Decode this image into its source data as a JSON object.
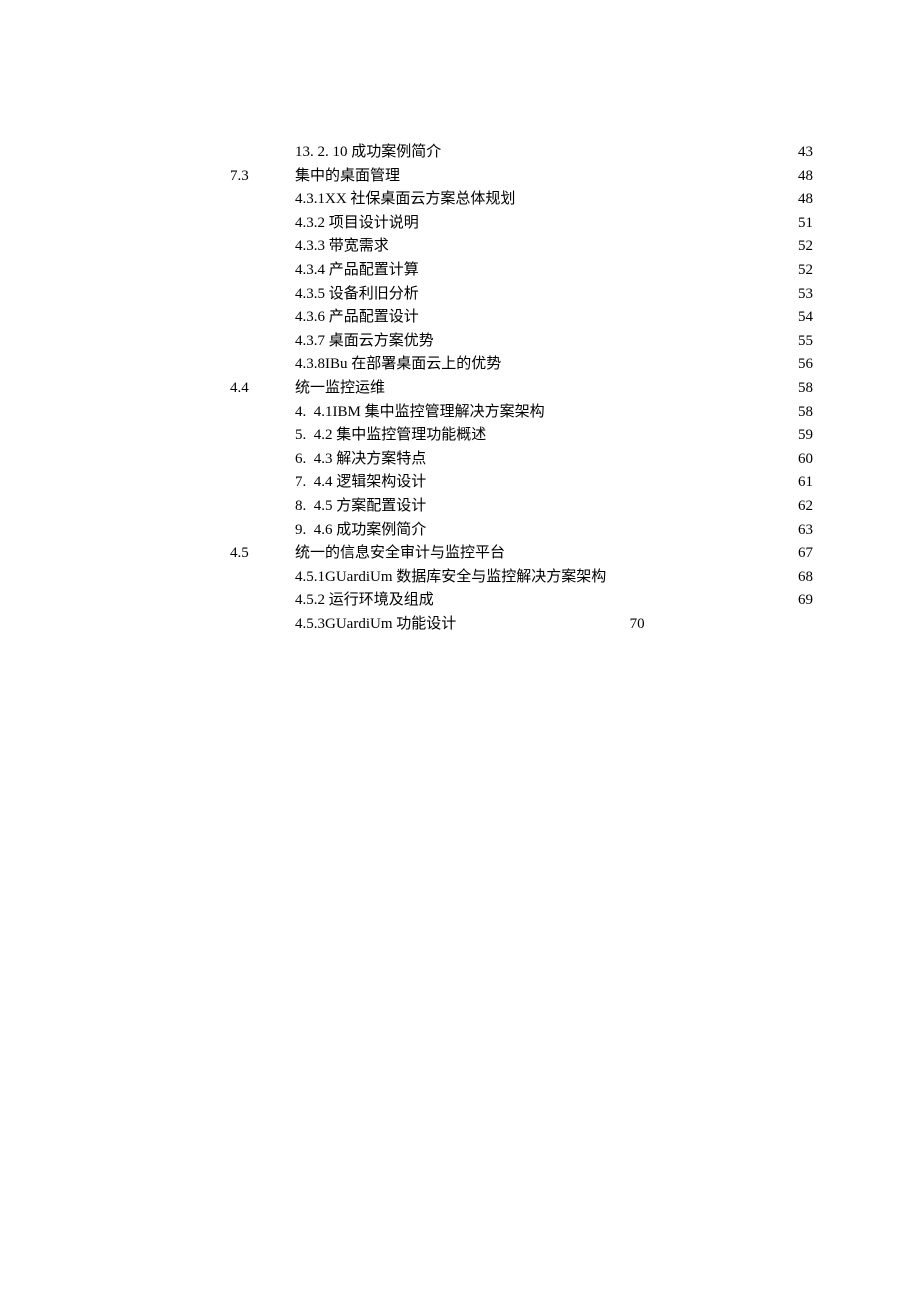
{
  "rows": [
    {
      "sec": "",
      "title": "13. 2. 10 成功案例简介",
      "page": "43"
    },
    {
      "sec": "7.3",
      "title": "集中的桌面管理",
      "page": "48"
    },
    {
      "sec": "",
      "title": "4.3.1XX 社保桌面云方案总体规划",
      "page": "48"
    },
    {
      "sec": "",
      "title": "4.3.2 项目设计说明",
      "page": "51"
    },
    {
      "sec": "",
      "title": "4.3.3 带宽需求",
      "page": "52"
    },
    {
      "sec": "",
      "title": "4.3.4 产品配置计算",
      "page": "52"
    },
    {
      "sec": "",
      "title": "4.3.5 设备利旧分析",
      "page": "53"
    },
    {
      "sec": "",
      "title": "4.3.6 产品配置设计",
      "page": "54"
    },
    {
      "sec": "",
      "title": "4.3.7 桌面云方案优势",
      "page": "55"
    },
    {
      "sec": "",
      "title": "4.3.8IBu 在部署桌面云上的优势",
      "page": "56"
    },
    {
      "sec": "4.4",
      "title": "统一监控运维",
      "page": "58"
    },
    {
      "sec": "",
      "title": "4.  4.1IBM 集中监控管理解决方案架构",
      "page": "58"
    },
    {
      "sec": "",
      "title": "5.  4.2 集中监控管理功能概述",
      "page": "59"
    },
    {
      "sec": "",
      "title": "6.  4.3 解决方案特点",
      "page": "60"
    },
    {
      "sec": "",
      "title": "7.  4.4 逻辑架构设计",
      "page": "61"
    },
    {
      "sec": "",
      "title": "8.  4.5 方案配置设计",
      "page": "62"
    },
    {
      "sec": "",
      "title": "9.  4.6 成功案例简介",
      "page": "63"
    },
    {
      "sec": "4.5",
      "title": "统一的信息安全审计与监控平台",
      "page": "67"
    },
    {
      "sec": "",
      "title": "4.5.1GUardiUm 数据库安全与监控解决方案架构",
      "page": "68"
    },
    {
      "sec": "",
      "title": "4.5.2 运行环境及组成",
      "page": "69"
    }
  ],
  "last": {
    "sec": "",
    "title": "4.5.3GUardiUm 功能设计",
    "mid": "70"
  }
}
